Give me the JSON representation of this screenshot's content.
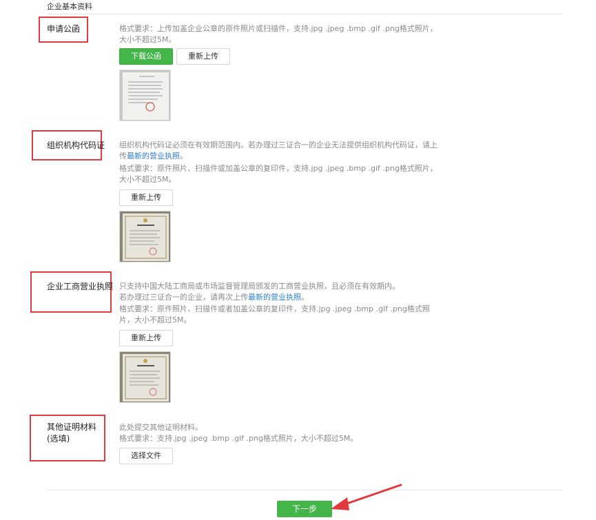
{
  "section_title": "企业基本资料",
  "colors": {
    "accent_green": "#43b549",
    "annotation_red": "#e0393e",
    "link_blue": "#2d7fd3"
  },
  "rows": {
    "letter": {
      "label": "申请公函",
      "desc": "格式要求：上传加盖企业公章的原件照片或扫描件，支持.jpg .jpeg .bmp .gif .png格式照片，大小不超过5M。",
      "download_label": "下载公函",
      "reupload_label": "重新上传",
      "thumb_icon": "letter-document-thumbnail"
    },
    "orgcode": {
      "label": "组织机构代码证",
      "desc_prefix": "组织机构代码证必须在有效期范围内。若办理过三证合一的企业无法提供组织机构代码证，请上传",
      "desc_link": "最新的营业执照",
      "desc_suffix": "。",
      "desc2": "格式要求：原件照片、扫描件或加盖公章的复印件，支持.jpg .jpeg .bmp .gif .png格式照片，大小不超过5M。",
      "reupload_label": "重新上传",
      "thumb_icon": "license-document-thumbnail"
    },
    "bizlicense": {
      "label": "企业工商营业执照",
      "desc1": "只支持中国大陆工商局或市场监督管理局颁发的工商营业执照，且必须在有效期内。",
      "desc2_prefix": "若办理过三证合一的企业，请再次上传",
      "desc2_link": "最新的营业执照",
      "desc2_suffix": "。",
      "desc3": "格式要求：原件照片、扫描件或者加盖公章的复印件，支持.jpg .jpeg .bmp .gif .png格式照片，大小不超过5M。",
      "reupload_label": "重新上传",
      "thumb_icon": "license-document-thumbnail"
    },
    "other": {
      "label_line1": "其他证明材料",
      "label_line2": "(选填)",
      "desc1": "此处提交其他证明材料。",
      "desc2": "格式要求：支持.jpg .jpeg .bmp .gif .png格式照片，大小不超过5M。",
      "choose_label": "选择文件"
    }
  },
  "next_label": "下一步",
  "arrow_icon": "red-pointer-arrow"
}
